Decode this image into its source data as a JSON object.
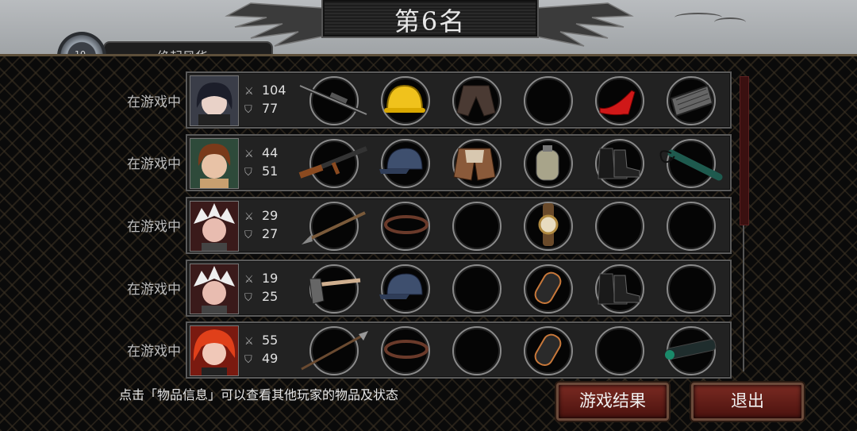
{
  "header": {
    "rank_title": "第6名",
    "player_name_partial": "绝起风华",
    "level_partial": "10"
  },
  "rows": [
    {
      "status": "在游戏中",
      "attack": "104",
      "defense": "77",
      "avatar": "dark-hair-girl",
      "items": [
        "sniper-rifle",
        "yellow-helmet",
        "leather-jacket",
        "empty",
        "red-heels",
        "rifle-magazine"
      ]
    },
    {
      "status": "在游戏中",
      "attack": "44",
      "defense": "51",
      "avatar": "brown-hair-girl",
      "items": [
        "ak-rifle",
        "blue-cap",
        "brown-vest",
        "canteen",
        "combat-boots",
        "baton"
      ]
    },
    {
      "status": "在游戏中",
      "attack": "29",
      "defense": "27",
      "avatar": "white-hair-girl",
      "items": [
        "spear",
        "headband",
        "empty",
        "wristwatch",
        "empty",
        "empty"
      ]
    },
    {
      "status": "在游戏中",
      "attack": "19",
      "defense": "25",
      "avatar": "white-hair-girl",
      "items": [
        "axe",
        "blue-cap",
        "empty",
        "bandage-roll",
        "combat-boots",
        "empty"
      ]
    },
    {
      "status": "在游戏中",
      "attack": "55",
      "defense": "49",
      "avatar": "red-hair-girl",
      "items": [
        "spear",
        "headband",
        "empty",
        "bandage-roll",
        "empty",
        "scope"
      ]
    }
  ],
  "footer": {
    "hint": "点击「物品信息」可以查看其他玩家的物品及状态",
    "result_button": "游戏结果",
    "exit_button": "退出"
  },
  "colors": {
    "button": "#5e1a14",
    "row_bg": "#222222",
    "status_text": "#bdbdbd"
  }
}
